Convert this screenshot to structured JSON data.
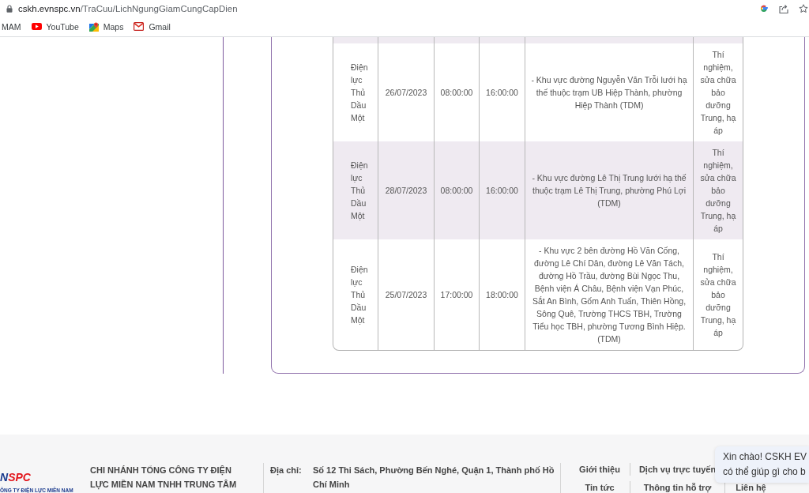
{
  "browser": {
    "url_host": "cskh.evnspc.vn",
    "url_path": "/TraCuu/LichNgungGiamCungCapDien"
  },
  "bookmarks": [
    {
      "kind": "plain",
      "label": "MAM"
    },
    {
      "kind": "youtube",
      "label": "YouTube"
    },
    {
      "kind": "maps",
      "label": "Maps"
    },
    {
      "kind": "gmail",
      "label": "Gmail"
    }
  ],
  "table": {
    "rows": [
      {
        "cells": [
          "Điện lực Thủ Dầu Một",
          "26/07/2023",
          "08:00:00",
          "16:00:00",
          "- Khu vực đường Nguyễn Văn Trỗi lưới hạ thế thuộc trạm UB Hiệp Thành, phường Hiệp Thành (TDM)",
          "Thí nghiệm, sửa chữa bảo dưỡng Trung, hạ áp"
        ]
      },
      {
        "cells": [
          "Điện lực Thủ Dầu Một",
          "28/07/2023",
          "08:00:00",
          "16:00:00",
          "- Khu vực đường Lê Thị Trung lưới hạ thế thuộc trạm Lê Thị Trung, phường Phú Lợi (TDM)",
          "Thí nghiệm, sửa chữa bảo dưỡng Trung, hạ áp"
        ]
      },
      {
        "cells": [
          "Điện lực Thủ Dầu Một",
          "25/07/2023",
          "17:00:00",
          "18:00:00",
          "- Khu vực 2 bên đường Hồ Văn Cống, đường Lê Chí Dân, đường Lê Văn Tách, đường Hồ Trầu, đường Bùi Ngọc Thu, Bệnh viện Á Châu, Bệnh viện Vạn Phúc, Sắt An Bình, Gốm Anh Tuấn, Thiên Hồng, Sông Quê, Trường THCS TBH, Trường Tiểu học TBH, phường Tương Bình Hiệp.(TDM)",
          "Thí nghiệm, sửa chữa bảo dưỡng Trung, hạ áp"
        ]
      }
    ]
  },
  "footer": {
    "logo": {
      "lead": "N",
      "accent": "SPC",
      "subtitle": "ÔNG TY ĐIỆN LỰC MIỀN NAM"
    },
    "company": "CHI NHÁNH TỔNG CÔNG TY ĐIỆN LỰC MIỀN NAM TNHH TRUNG TÂM",
    "address": {
      "label": "Địa chỉ:",
      "value": "Số 12 Thi Sách, Phường Bến Nghé, Quận 1, Thành phố Hồ Chí Minh"
    },
    "link_rows": [
      [
        "Giới thiệu",
        "Dịch vụ trực tuyến"
      ],
      [
        "Tin tức",
        "Thông tin hỗ trợ",
        "Liên hệ"
      ]
    ]
  },
  "chat": {
    "message": "Xin chào! CSKH EV\ncó thể giúp gì cho b"
  }
}
